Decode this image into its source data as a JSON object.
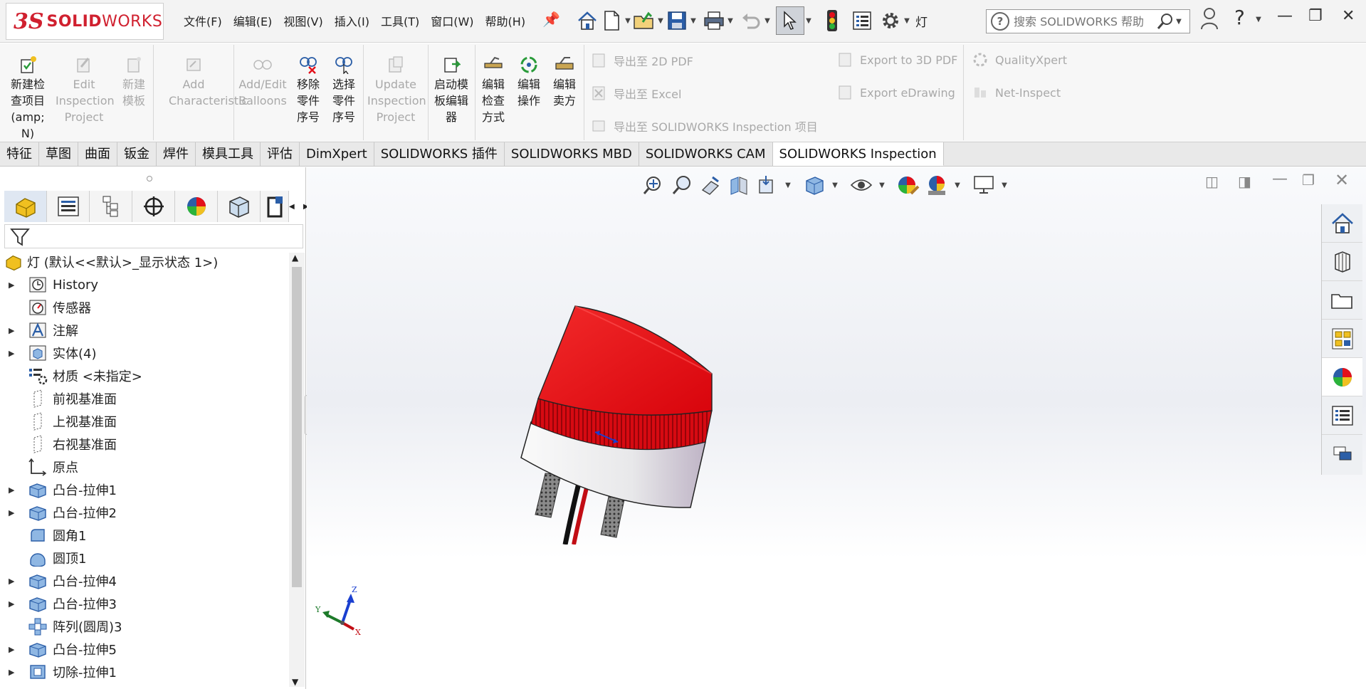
{
  "app": {
    "logo_prefix": "3S",
    "logo_bold": "SOLID",
    "logo_rest": "WORKS",
    "document_name": "灯"
  },
  "menu": [
    "文件(F)",
    "编辑(E)",
    "视图(V)",
    "插入(I)",
    "工具(T)",
    "窗口(W)",
    "帮助(H)"
  ],
  "search": {
    "placeholder": "搜索 SOLIDWORKS 帮助"
  },
  "help_label": "?",
  "commands": {
    "new_inspection": "新建检查项目(amp;N)",
    "edit_inspection": "Edit Inspection Project",
    "new_template": "新建模板",
    "add_characteristic": "Add Characteristic",
    "add_edit_balloons": "Add/Edit Balloons",
    "remove_sequence": "移除零件序号",
    "select_sequence": "选择零件序号",
    "update_inspection": "Update Inspection Project",
    "launch_template_editor": "启动模板编辑器",
    "edit_check_method": "编辑检查方式",
    "edit_operation": "编辑操作",
    "edit_vendor": "编辑卖方",
    "export_2d_pdf": "导出至 2D PDF",
    "export_excel": "导出至 Excel",
    "export_sw_inspection": "导出至 SOLIDWORKS Inspection 项目",
    "export_3d_pdf": "Export to 3D PDF",
    "export_edrawing": "Export eDrawing",
    "qualityxpert": "QualityXpert",
    "net_inspect": "Net-Inspect"
  },
  "tabs": [
    "特征",
    "草图",
    "曲面",
    "钣金",
    "焊件",
    "模具工具",
    "评估",
    "DimXpert",
    "SOLIDWORKS 插件",
    "SOLIDWORKS MBD",
    "SOLIDWORKS CAM",
    "SOLIDWORKS Inspection"
  ],
  "active_tab": "SOLIDWORKS Inspection",
  "tree": {
    "root": "灯  (默认<<默认>_显示状态 1>)",
    "items": [
      "History",
      "传感器",
      "注解",
      "实体(4)",
      "材质 <未指定>",
      "前视基准面",
      "上视基准面",
      "右视基准面",
      "原点",
      "凸台-拉伸1",
      "凸台-拉伸2",
      "圆角1",
      "圆顶1",
      "凸台-拉伸4",
      "凸台-拉伸3",
      "阵列(圆周)3",
      "凸台-拉伸5",
      "切除-拉伸1"
    ]
  },
  "triad": {
    "x": "X",
    "y": "Y",
    "z": "Z"
  },
  "colors": {
    "accent": "#d0202f",
    "lamp_red": "#e3101a",
    "blue": "#2b66c4"
  }
}
